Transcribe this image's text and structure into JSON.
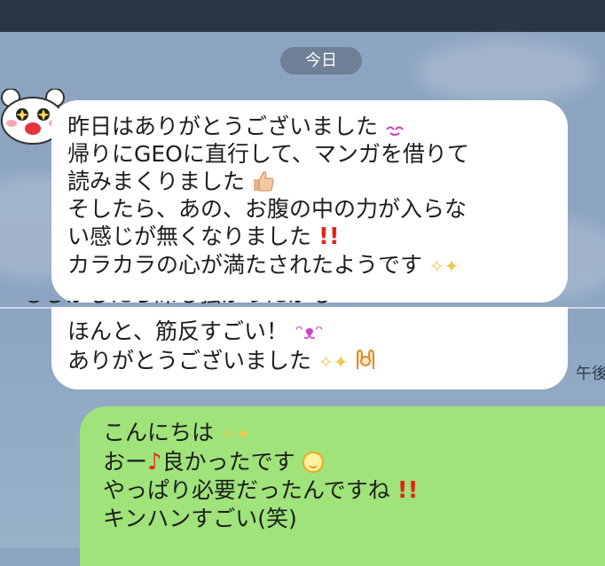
{
  "header": {
    "date_label": "今日"
  },
  "incoming": {
    "lines_top": [
      "昨日はありがとうございました",
      "帰りにGEOに直行して、マンガを借りて",
      "読みまくりました",
      "そしたら、あの、お腹の中の力が入らな",
      "い感じが無くなりました",
      "カラカラの心が満たされたようです"
    ],
    "clipped_line": "もしかしたら深も強かったかも",
    "lines_bottom": [
      "ほんと、筋反すごい！",
      "ありがとうございました"
    ],
    "time_label": "午後"
  },
  "outgoing": {
    "lines": [
      "こんにちは",
      "おー",
      "良かったです",
      "やっぱり必要だったんですね",
      "キンハンすごい(笑)"
    ]
  },
  "icons": {
    "avatar": "white-bear-avatar-icon",
    "smile": "smiling-eyes-icon",
    "thumb": "thumbs-up-icon",
    "bang": "double-exclamation-icon",
    "sparkle": "sparkles-icon",
    "grin": "grinning-face-icon",
    "praise": "praising-hands-icon",
    "note": "music-note-icon",
    "smiley": "smiley-face-icon"
  },
  "colors": {
    "outgoing_bubble": "#9fe37a",
    "incoming_bubble": "#ffffff",
    "chat_background": "#8da4c0",
    "date_pill": "#6f7f95"
  }
}
